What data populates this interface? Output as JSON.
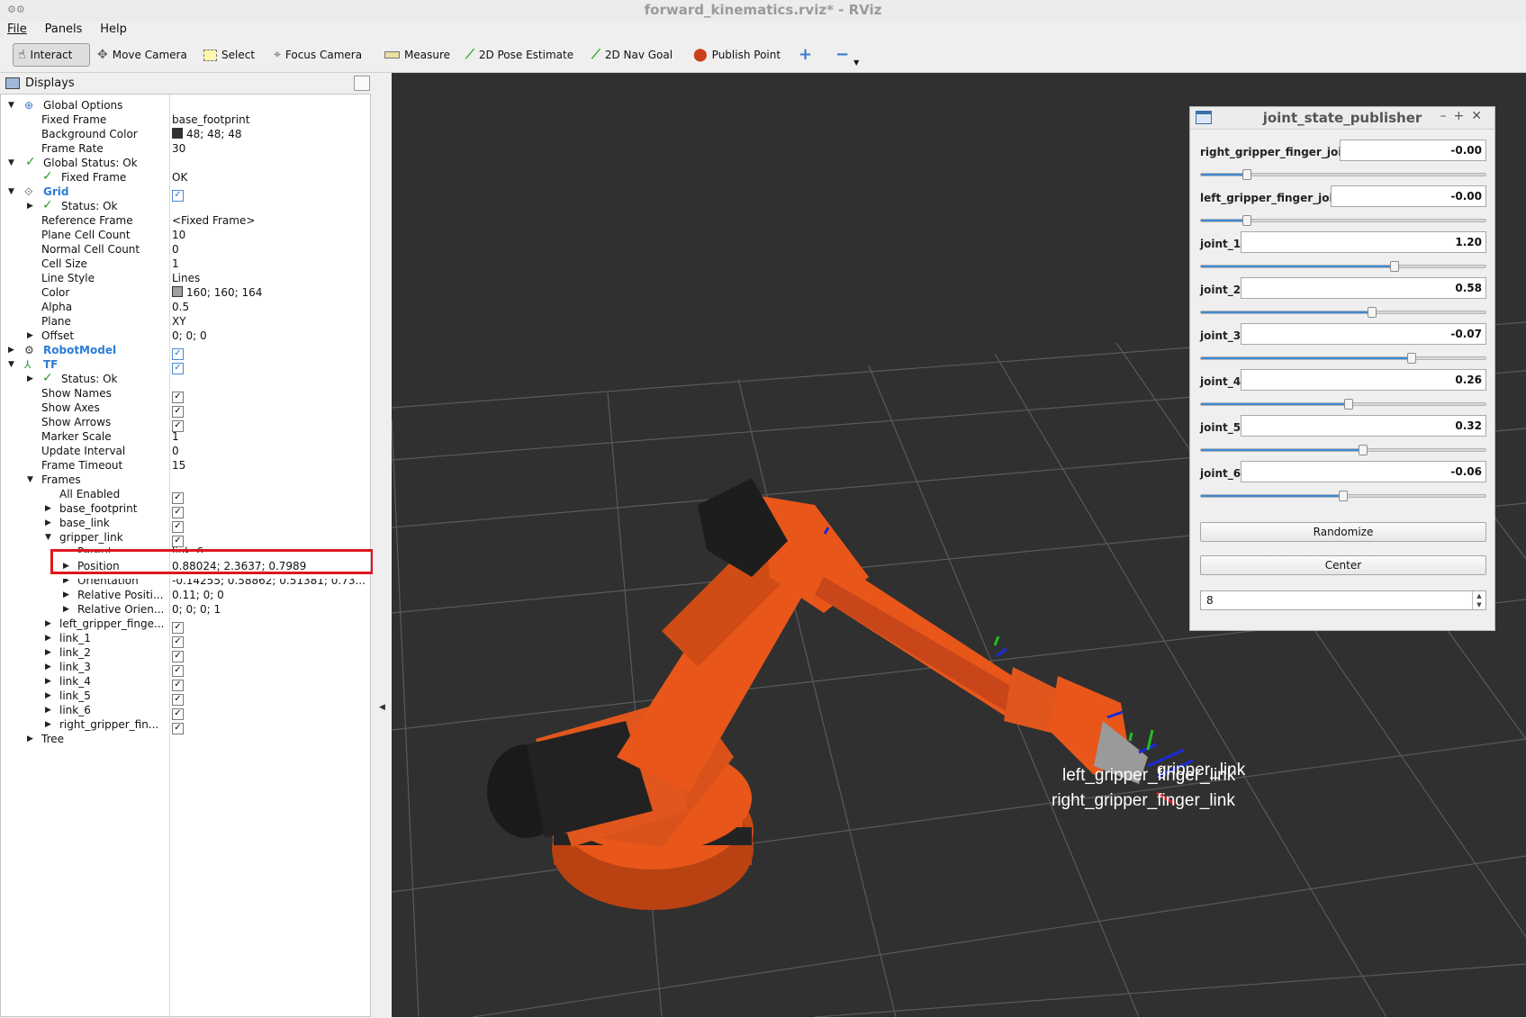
{
  "window": {
    "title": "forward_kinematics.rviz* - RViz",
    "icon": "rviz-window-icon"
  },
  "menu": {
    "file": "File",
    "panels": "Panels",
    "help": "Help"
  },
  "toolbar": {
    "interact": "Interact",
    "move_camera": "Move Camera",
    "select": "Select",
    "focus_camera": "Focus Camera",
    "measure": "Measure",
    "pose_estimate": "2D Pose Estimate",
    "nav_goal": "2D Nav Goal",
    "publish_point": "Publish Point"
  },
  "displays": {
    "title": "Displays",
    "rows": {
      "global_options": "Global Options",
      "fixed_frame": {
        "label": "Fixed Frame",
        "value": "base_footprint"
      },
      "background_color": {
        "label": "Background Color",
        "value": "48; 48; 48",
        "color": "#303030"
      },
      "frame_rate": {
        "label": "Frame Rate",
        "value": "30"
      },
      "global_status": "Global Status: Ok",
      "gs_fixed_frame": {
        "label": "Fixed Frame",
        "value": "OK"
      },
      "grid": "Grid",
      "grid_status": "Status: Ok",
      "reference_frame": {
        "label": "Reference Frame",
        "value": "<Fixed Frame>"
      },
      "plane_cell_count": {
        "label": "Plane Cell Count",
        "value": "10"
      },
      "normal_cell_count": {
        "label": "Normal Cell Count",
        "value": "0"
      },
      "cell_size": {
        "label": "Cell Size",
        "value": "1"
      },
      "line_style": {
        "label": "Line Style",
        "value": "Lines"
      },
      "grid_color": {
        "label": "Color",
        "value": "160; 160; 164",
        "color": "#a0a0a4"
      },
      "alpha": {
        "label": "Alpha",
        "value": "0.5"
      },
      "plane": {
        "label": "Plane",
        "value": "XY"
      },
      "offset": {
        "label": "Offset",
        "value": "0; 0; 0"
      },
      "robot_model": "RobotModel",
      "tf": "TF",
      "tf_status": "Status: Ok",
      "show_names": "Show Names",
      "show_axes": "Show Axes",
      "show_arrows": "Show Arrows",
      "marker_scale": {
        "label": "Marker Scale",
        "value": "1"
      },
      "update_interval": {
        "label": "Update Interval",
        "value": "0"
      },
      "frame_timeout": {
        "label": "Frame Timeout",
        "value": "15"
      },
      "frames": "Frames",
      "all_enabled": "All Enabled",
      "base_footprint": "base_footprint",
      "base_link": "base_link",
      "gripper_link": "gripper_link",
      "parent": {
        "label": "Parent",
        "value": "link_6"
      },
      "position": {
        "label": "Position",
        "value": "0.88024; 2.3637; 0.7989"
      },
      "orientation": {
        "label": "Orientation",
        "value": "-0.14255; 0.58862; 0.51381; 0.73..."
      },
      "relative_position": {
        "label": "Relative Positi...",
        "value": "0.11; 0; 0"
      },
      "relative_orientation": {
        "label": "Relative Orien...",
        "value": "0; 0; 0; 1"
      },
      "left_gripper": "left_gripper_finge...",
      "link_1": "link_1",
      "link_2": "link_2",
      "link_3": "link_3",
      "link_4": "link_4",
      "link_5": "link_5",
      "link_6": "link_6",
      "right_gripper": "right_gripper_fin...",
      "tree": "Tree"
    }
  },
  "viewport": {
    "label_gripper": "gripper_link",
    "label_left": "left_gripper_finger_link",
    "label_right": "right_gripper_finger_link",
    "robot_color": "#e8561a"
  },
  "joint_state_publisher": {
    "title": "joint_state_publisher",
    "joints": [
      {
        "name": "right_gripper_finger_joint",
        "value": "-0.00",
        "fraction": 0.16
      },
      {
        "name": "left_gripper_finger_joint",
        "value": "-0.00",
        "fraction": 0.16
      },
      {
        "name": "joint_1",
        "value": "1.20",
        "fraction": 0.68
      },
      {
        "name": "joint_2",
        "value": "0.58",
        "fraction": 0.6
      },
      {
        "name": "joint_3",
        "value": "-0.07",
        "fraction": 0.74
      },
      {
        "name": "joint_4",
        "value": "0.26",
        "fraction": 0.52
      },
      {
        "name": "joint_5",
        "value": "0.32",
        "fraction": 0.57
      },
      {
        "name": "joint_6",
        "value": "-0.06",
        "fraction": 0.5
      }
    ],
    "randomize": "Randomize",
    "center": "Center",
    "spin_value": "8"
  }
}
